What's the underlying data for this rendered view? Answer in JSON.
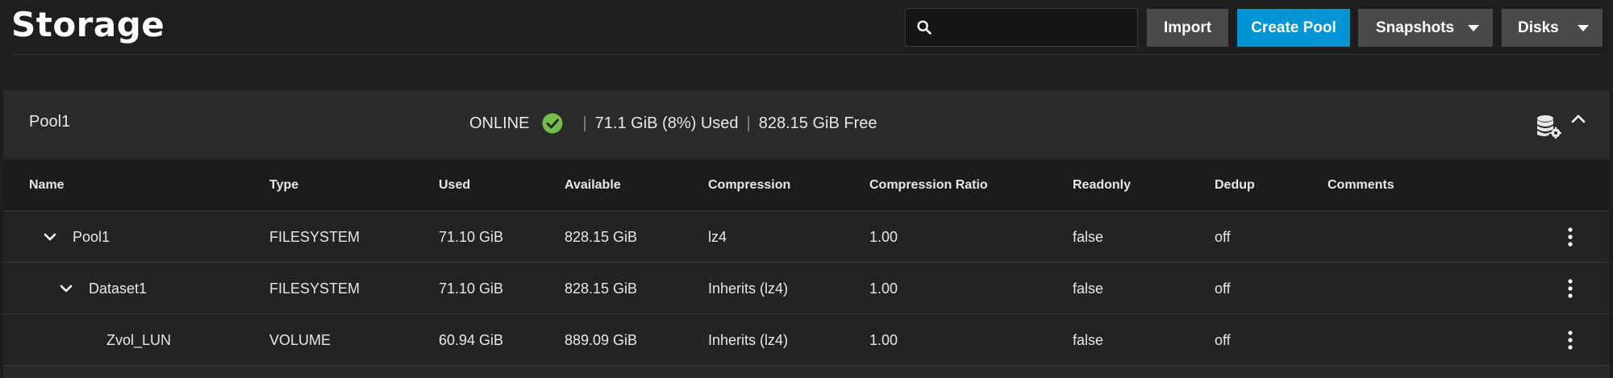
{
  "page": {
    "title": "Storage"
  },
  "header": {
    "search": {
      "value": "",
      "placeholder": ""
    },
    "import_label": "Import",
    "create_pool_label": "Create Pool",
    "snapshots_label": "Snapshots",
    "disks_label": "Disks"
  },
  "pool": {
    "name": "Pool1",
    "state": "ONLINE",
    "used": "71.1 GiB (8%) Used",
    "free": "828.15 GiB Free",
    "separator": "|"
  },
  "table": {
    "columns": [
      "Name",
      "Type",
      "Used",
      "Available",
      "Compression",
      "Compression Ratio",
      "Readonly",
      "Dedup",
      "Comments"
    ],
    "rows": [
      {
        "name": "Pool1",
        "type": "FILESYSTEM",
        "used": "71.10 GiB",
        "available": "828.15 GiB",
        "compression": "lz4",
        "ratio": "1.00",
        "readonly": "false",
        "dedup": "off",
        "comments": ""
      },
      {
        "name": "Dataset1",
        "type": "FILESYSTEM",
        "used": "71.10 GiB",
        "available": "828.15 GiB",
        "compression": "Inherits (lz4)",
        "ratio": "1.00",
        "readonly": "false",
        "dedup": "off",
        "comments": ""
      },
      {
        "name": "Zvol_LUN",
        "type": "VOLUME",
        "used": "60.94 GiB",
        "available": "889.09 GiB",
        "compression": "Inherits (lz4)",
        "ratio": "1.00",
        "readonly": "false",
        "dedup": "off",
        "comments": ""
      }
    ]
  },
  "icons": {
    "search": "search-icon",
    "dropdown": "caret-down-icon",
    "status_ok": "check-circle-icon",
    "pool_settings": "database-gear-icon",
    "collapse": "chevron-up-icon",
    "expand": "chevron-down-icon",
    "row_menu": "more-vertical-icon"
  },
  "colors": {
    "background": "#1e1e1e",
    "card": "#282828",
    "accent": "#0095d5",
    "button_gray": "#4a4a4a",
    "status_ok": "#71bf44"
  }
}
